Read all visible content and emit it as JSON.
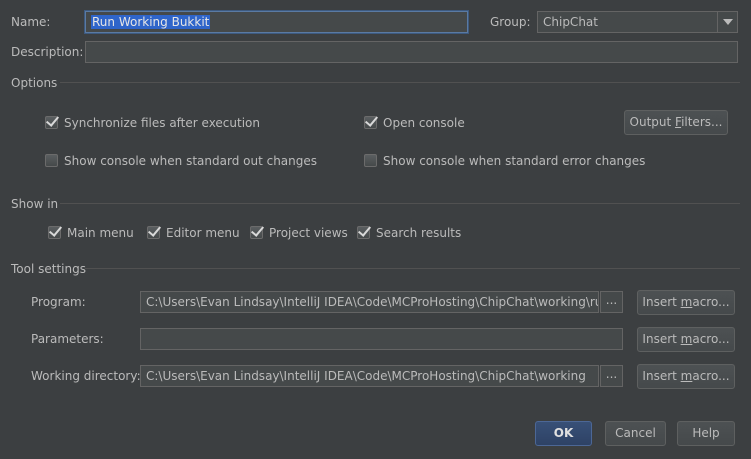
{
  "general": {
    "name_label": "Name:",
    "name_value": "Run Working Bukkit",
    "group_label": "Group:",
    "group_value": "ChipChat",
    "description_label": "Description:",
    "description_value": ""
  },
  "options": {
    "title": "Options",
    "sync_files": {
      "label": "Synchronize files after execution",
      "checked": true
    },
    "open_console": {
      "label": "Open console",
      "checked": true
    },
    "output_filters_label_pre": "Output ",
    "output_filters_label_ul": "F",
    "output_filters_label_post": "ilters...",
    "console_stdout": {
      "label": "Show console when standard out changes",
      "checked": false
    },
    "console_stderr": {
      "label": "Show console when standard error changes",
      "checked": false
    }
  },
  "show_in": {
    "title": "Show in",
    "items": [
      {
        "label": "Main menu",
        "checked": true
      },
      {
        "label": "Editor menu",
        "checked": true
      },
      {
        "label": "Project views",
        "checked": true
      },
      {
        "label": "Search results",
        "checked": true
      }
    ]
  },
  "tool_settings": {
    "title": "Tool settings",
    "program_label": "Program:",
    "program_value": "C:\\Users\\Evan Lindsay\\IntelliJ IDEA\\Code\\MCProHosting\\ChipChat\\working\\run.bat",
    "parameters_label": "Parameters:",
    "parameters_value": "",
    "workdir_label": "Working directory:",
    "workdir_value": "C:\\Users\\Evan Lindsay\\IntelliJ IDEA\\Code\\MCProHosting\\ChipChat\\working",
    "browse_label": "...",
    "insert_macro_pre": "Insert ",
    "insert_macro_ul": "m",
    "insert_macro_post": "acro..."
  },
  "footer": {
    "ok_label": "OK",
    "cancel_label": "Cancel",
    "help_label": "Help"
  }
}
